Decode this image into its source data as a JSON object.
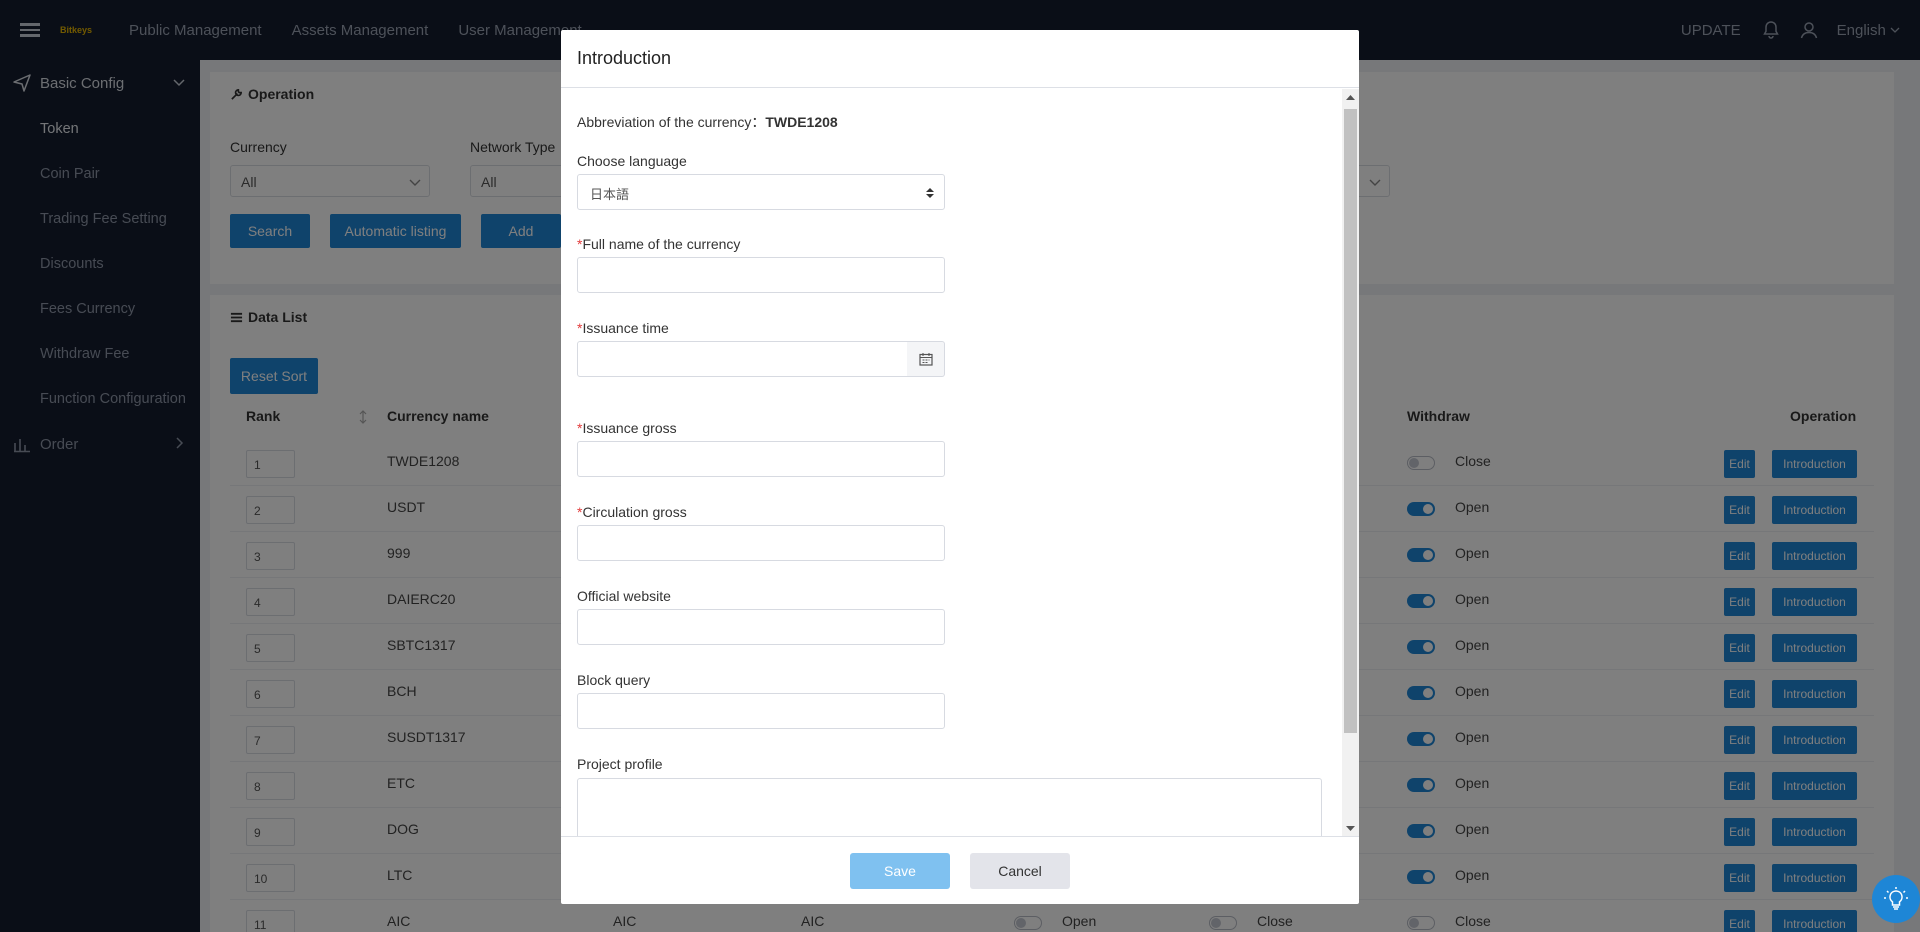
{
  "topbar": {
    "logo_text": "Bitkeys",
    "nav": [
      "Public Management",
      "Assets Management",
      "User Management"
    ],
    "update_label": "UPDATE",
    "language": "English"
  },
  "sidebar": {
    "group_basic": "Basic Config",
    "items": [
      "Token",
      "Coin Pair",
      "Trading Fee Setting",
      "Discounts",
      "Fees Currency",
      "Withdraw Fee",
      "Function Configuration"
    ],
    "group_order": "Order"
  },
  "operation": {
    "title": "Operation",
    "currency_label": "Currency",
    "currency_value": "All",
    "network_label": "Network Type",
    "network_value": "All",
    "search_label": "Search",
    "auto_listing_label": "Automatic listing",
    "add_label": "Add"
  },
  "data_list": {
    "title": "Data List",
    "reset_sort_label": "Reset Sort",
    "headers": {
      "rank": "Rank",
      "currency": "Currency name",
      "withdraw": "Withdraw",
      "operation": "Operation"
    },
    "edit_label": "Edit",
    "intro_label": "Introduction",
    "rows": [
      {
        "rank": "1",
        "name": "TWDE1208",
        "withdraw": "Close"
      },
      {
        "rank": "2",
        "name": "USDT",
        "withdraw": "Open"
      },
      {
        "rank": "3",
        "name": "999",
        "withdraw": "Open"
      },
      {
        "rank": "4",
        "name": "DAIERC20",
        "withdraw": "Open"
      },
      {
        "rank": "5",
        "name": "SBTC1317",
        "withdraw": "Open"
      },
      {
        "rank": "6",
        "name": "BCH",
        "withdraw": "Open"
      },
      {
        "rank": "7",
        "name": "SUSDT1317",
        "withdraw": "Open"
      },
      {
        "rank": "8",
        "name": "ETC",
        "withdraw": "Open"
      },
      {
        "rank": "9",
        "name": "DOG",
        "withdraw": "Open"
      },
      {
        "rank": "10",
        "name": "LTC",
        "withdraw": "Open"
      },
      {
        "rank": "11",
        "name": "AIC",
        "col3": "AIC",
        "col4": "AIC",
        "status1": "Open",
        "status2": "Close",
        "withdraw": "Close"
      }
    ]
  },
  "modal": {
    "title": "Introduction",
    "abbrev_label": "Abbreviation of the currency：",
    "abbrev_value": "TWDE1208",
    "language_label": "Choose language",
    "language_value": "日本語",
    "required_mark": "*",
    "full_name_label": "Full name of the currency",
    "issuance_time_label": "Issuance time",
    "issuance_gross_label": "Issuance gross",
    "circulation_gross_label": "Circulation gross",
    "website_label": "Official website",
    "block_query_label": "Block query",
    "profile_label": "Project profile",
    "save_label": "Save",
    "cancel_label": "Cancel"
  },
  "colors": {
    "accent": "#1e86d6",
    "topbar": "#141d2e",
    "save_disabled": "#7fc1f0"
  }
}
